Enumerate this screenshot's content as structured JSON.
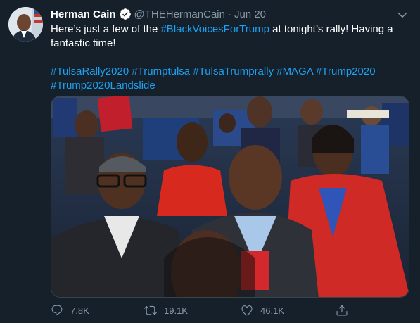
{
  "tweet": {
    "author_name": "Herman Cain",
    "handle": "@THEHermanCain",
    "separator": "·",
    "date": "Jun 20",
    "text_before": "Here’s just a few of the ",
    "text_link": "#BlackVoicesForTrump",
    "text_after": " at tonight’s rally!  Having a fantastic time!",
    "hashtags_line1": "#TulsaRally2020 #Trumptulsa #TulsaTrumprally #MAGA #Trump2020",
    "hashtags_line2": "#Trump2020Landslide"
  },
  "actions": {
    "replies": "7.8K",
    "retweets": "19.1K",
    "likes": "46.1K"
  },
  "icons": {
    "verified": "verified-badge-icon",
    "caret": "chevron-down-icon",
    "reply": "reply-icon",
    "retweet": "retweet-icon",
    "like": "heart-icon",
    "share": "share-icon"
  },
  "colors": {
    "background": "#15202b",
    "link": "#1da1f2",
    "muted": "#8899a6",
    "border": "#38444d"
  }
}
